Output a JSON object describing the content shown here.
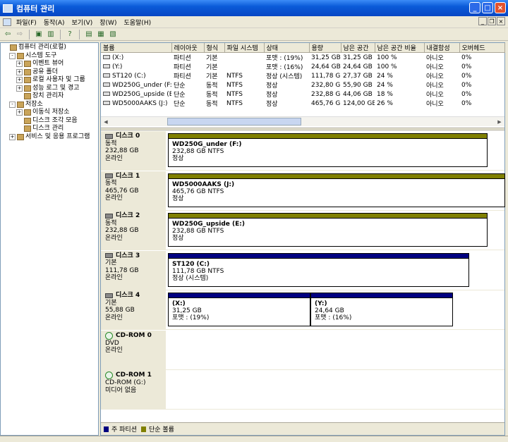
{
  "window": {
    "title": "컴퓨터 관리"
  },
  "menu": [
    "파일(F)",
    "동작(A)",
    "보기(V)",
    "창(W)",
    "도움말(H)"
  ],
  "tree": [
    {
      "label": "컴퓨터 관리(로컬)",
      "level": 0,
      "expander": ""
    },
    {
      "label": "시스템 도구",
      "level": 1,
      "expander": "-"
    },
    {
      "label": "이벤트 뷰어",
      "level": 2,
      "expander": "+"
    },
    {
      "label": "공유 폴더",
      "level": 2,
      "expander": "+"
    },
    {
      "label": "로컬 사용자 및 그룹",
      "level": 2,
      "expander": "+"
    },
    {
      "label": "성능 로그 및 경고",
      "level": 2,
      "expander": "+"
    },
    {
      "label": "장치 관리자",
      "level": 2,
      "expander": ""
    },
    {
      "label": "저장소",
      "level": 1,
      "expander": "-"
    },
    {
      "label": "이동식 저장소",
      "level": 2,
      "expander": "+"
    },
    {
      "label": "디스크 조각 모음",
      "level": 2,
      "expander": ""
    },
    {
      "label": "디스크 관리",
      "level": 2,
      "expander": ""
    },
    {
      "label": "서비스 및 응용 프로그램",
      "level": 1,
      "expander": "+"
    }
  ],
  "volume_columns": [
    "볼륨",
    "레이아웃",
    "형식",
    "파일 시스템",
    "상태",
    "용량",
    "남은 공간",
    "남은 공간 비율",
    "내결함성",
    "오버헤드"
  ],
  "volumes": [
    [
      "(X:)",
      "파티션",
      "기본",
      "",
      "포맷 : (19%)",
      "31,25 GB",
      "31,25 GB",
      "100 %",
      "아니오",
      "0%"
    ],
    [
      "(Y:)",
      "파티션",
      "기본",
      "",
      "포맷 : (16%)",
      "24,64 GB",
      "24,64 GB",
      "100 %",
      "아니오",
      "0%"
    ],
    [
      "ST120 (C:)",
      "파티션",
      "기본",
      "NTFS",
      "정상 (시스템)",
      "111,78 GB",
      "27,37 GB",
      "24 %",
      "아니오",
      "0%"
    ],
    [
      "WD250G_under (F:)",
      "단순",
      "동적",
      "NTFS",
      "정상",
      "232,80 GB",
      "55,90 GB",
      "24 %",
      "아니오",
      "0%"
    ],
    [
      "WD250G_upside (E:)",
      "단순",
      "동적",
      "NTFS",
      "정상",
      "232,88 GB",
      "44,06 GB",
      "18 %",
      "아니오",
      "0%"
    ],
    [
      "WD5000AAKS (J:)",
      "단순",
      "동적",
      "NTFS",
      "정상",
      "465,76 GB",
      "124,00 GB",
      "26 %",
      "아니오",
      "0%"
    ]
  ],
  "disks": [
    {
      "name": "디스크 0",
      "kind": "hdd",
      "type": "동적",
      "size": "232,88 GB",
      "state": "온라인",
      "partitions": [
        {
          "name": "WD250G_under  (F:)",
          "size": "232,88 GB NTFS",
          "status": "정상",
          "color": "#808000"
        }
      ]
    },
    {
      "name": "디스크 1",
      "kind": "hdd",
      "type": "동적",
      "size": "465,76 GB",
      "state": "온라인",
      "partitions": [
        {
          "name": "WD5000AAKS  (J:)",
          "size": "465,76 GB NTFS",
          "status": "정상",
          "color": "#808000"
        }
      ]
    },
    {
      "name": "디스크 2",
      "kind": "hdd",
      "type": "동적",
      "size": "232,88 GB",
      "state": "온라인",
      "partitions": [
        {
          "name": "WD250G_upside  (E:)",
          "size": "232,88 GB NTFS",
          "status": "정상",
          "color": "#808000"
        }
      ]
    },
    {
      "name": "디스크 3",
      "kind": "hdd",
      "type": "기본",
      "size": "111,78 GB",
      "state": "온라인",
      "partitions": [
        {
          "name": "ST120  (C:)",
          "size": "111,78 GB NTFS",
          "status": "정상 (시스템)",
          "color": "#000080"
        }
      ]
    },
    {
      "name": "디스크 4",
      "kind": "hdd",
      "type": "기본",
      "size": "55,88 GB",
      "state": "온라인",
      "partitions": [
        {
          "name": "(X:)",
          "size": "31,25 GB",
          "status": "포맷 : (19%)",
          "color": "#000080"
        },
        {
          "name": "(Y:)",
          "size": "24,64 GB",
          "status": "포맷 : (16%)",
          "color": "#000080"
        }
      ]
    },
    {
      "name": "CD-ROM 0",
      "kind": "cd",
      "type": "DVD",
      "size": "",
      "state": "온라인",
      "partitions": []
    },
    {
      "name": "CD-ROM 1",
      "kind": "cd",
      "type": "CD-ROM (G:)",
      "size": "",
      "state": "미디어 없음",
      "partitions": []
    }
  ],
  "legend": [
    {
      "label": "주 파티션",
      "color": "#000080"
    },
    {
      "label": "단순 볼륨",
      "color": "#808000"
    }
  ]
}
